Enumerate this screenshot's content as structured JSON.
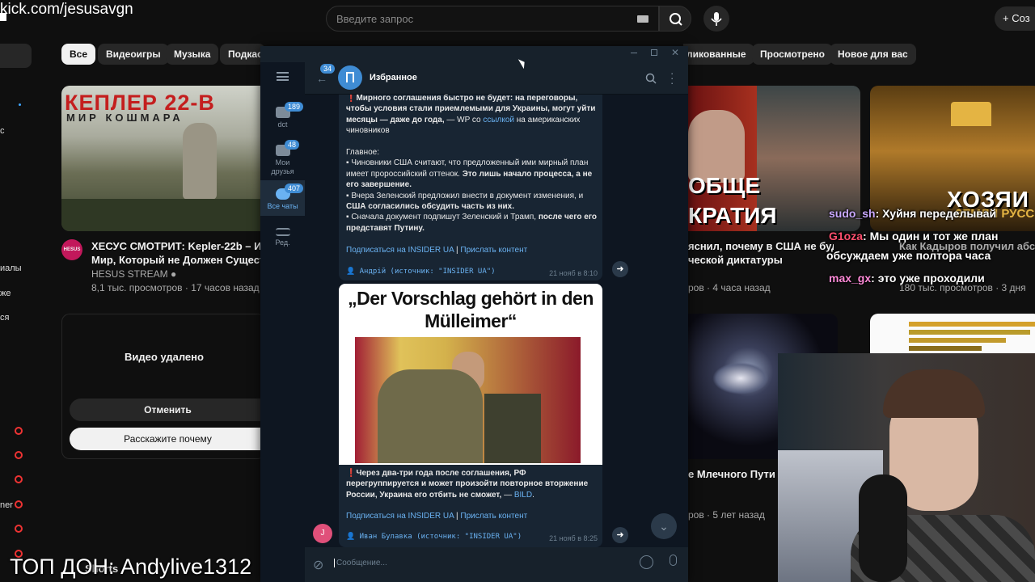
{
  "stream": {
    "url": "kick.com/jesusavgn",
    "top_donate": "ТОП ДОН: Andylive1312"
  },
  "youtube": {
    "search": {
      "placeholder": "Введите запрос"
    },
    "create_label": "Соз",
    "chips": [
      "Все",
      "Видеоигры",
      "Музыка",
      "Подкаст",
      "ликованные",
      "Просмотрено",
      "Новое для вас"
    ],
    "videos": [
      {
        "thumb_title": "КЕПЛЕР 22-В",
        "thumb_subtitle": "МИР КОШМАРА",
        "title_line1": "ХЕСУС СМОТРИТ: Kepler-22b – Инопл",
        "title_line2": "Мир, Который не Должен Существов",
        "channel": "HESUS STREAM",
        "avatar_label": "HESUS",
        "meta": "8,1 тыс. просмотров · 17 часов назад"
      },
      {
        "thumb_text1": "ОБЩЕ",
        "thumb_text2": "КРАТИЯ",
        "title_line1": "яснил, почему в США не будет",
        "title_line2": "ческой диктатуры",
        "meta": "ров · 4 часа назад"
      },
      {
        "thumb_text": "ХОЗЯИ",
        "thumb_text2": "ЗЕМЛИ РУСС",
        "title_line1": "Как Кадыров получил абсо",
        "meta": "180 тыс. просмотров · 3 дня"
      },
      {
        "title_line1": "е Млечного Пути и",
        "meta": "ров · 5 лет назад"
      }
    ],
    "deleted_card": {
      "title": "Видео удалено",
      "cancel": "Отменить",
      "tell_why": "Расскажите почему"
    },
    "sidebar": {
      "items": [
        "с",
        "иалы",
        "же",
        "ся",
        "ner"
      ],
      "shorts": "Shorts"
    }
  },
  "telegram": {
    "chat_title": "Избранное",
    "back_badge": "34",
    "rail": [
      {
        "label": "dct",
        "badge": "189"
      },
      {
        "label": "Мои друзья",
        "badge": "48"
      },
      {
        "label": "Все чаты",
        "badge": "407"
      },
      {
        "label": "Ред.",
        "badge": ""
      }
    ],
    "msg1": {
      "p1_bold": "Мирного соглашения быстро не будет: на переговоры, чтобы условия стали приемлемыми для Украины, могут уйти месяцы — даже до года,",
      "p1_rest": " — WP со ",
      "p1_link": "ссылкой",
      "p1_tail": " на американских чиновников",
      "heading": "Главное:",
      "b1_plain": "Чиновники США считают, что предложенный ими мирный план имеет пророссийский оттенок. ",
      "b1_bold": "Это лишь начало процесса, а не его завершение.",
      "b2_plain": "Вчера Зеленский предложил внести в документ изменения, и ",
      "b2_bold": "США согласились обсудить часть из них.",
      "b3_plain": "Сначала документ подпишут Зеленский и Трамп, ",
      "b3_bold": "после чего его представят Путину.",
      "subscribe": "Подписаться на INSIDER UA",
      "separator": "|",
      "send_content": "Прислать контент",
      "signature": "Андрій (источник: \"INSIDER UA\")",
      "time": "21 нояб в 8:10"
    },
    "msg2": {
      "headline": "„Der Vorschlag gehört in den Mülleimer“",
      "p_bold": "Через два-три года после соглашения, РФ перегруппируется и может произойти повторное вторжение России, Украина его отбить не сможет,",
      "p_rest": " — ",
      "p_link": "BILD",
      "p_tail": ".",
      "subscribe": "Подписаться на INSIDER UA",
      "separator": "|",
      "send_content": "Прислать контент",
      "signature": "Иван Булавка (источник: \"INSIDER UA\")",
      "time": "21 нояб в 8:25",
      "avatar_letter": "J"
    },
    "input_placeholder": "Сообщение..."
  },
  "stream_chat": [
    {
      "user": "sudo_sh",
      "color": "#c9a8ff",
      "text": ": Хуйня переделывай"
    },
    {
      "user": "G1oza",
      "color": "#ff4f6e",
      "text": ": Мы один и тот же план"
    },
    {
      "user": "",
      "color": "#ffffff",
      "text": "обсуждаем уже полтора часа"
    },
    {
      "user": "max_gx",
      "color": "#ff8ad8",
      "text": ": это уже проходили"
    }
  ],
  "colors": {
    "telegram_accent": "#3f8cd4",
    "youtube_bg": "#0f0f0f",
    "link": "#6ab2f2"
  }
}
